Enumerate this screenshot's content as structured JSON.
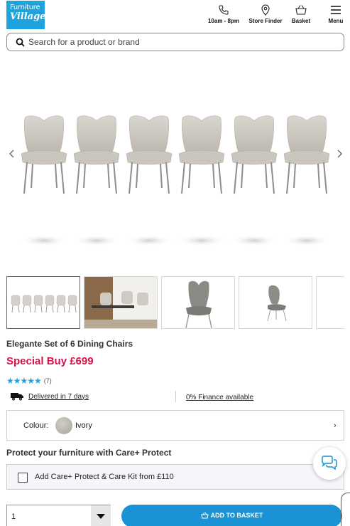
{
  "header": {
    "logo_line1": "Furniture",
    "logo_line2": "Village",
    "phone_label": "10am - 8pm",
    "store_label": "Store Finder",
    "basket_label": "Basket",
    "menu_label": "Menu"
  },
  "search": {
    "placeholder": "Search for a product or brand"
  },
  "product": {
    "title": "Elegante Set of 6 Dining Chairs",
    "price": "Special Buy £699",
    "stars": "★★★★★",
    "review_count": "(7)",
    "delivery": "Delivered in 7 days",
    "finance": "0% Finance available"
  },
  "colour": {
    "label": "Colour:",
    "value": "Ivory",
    "chevron": "›",
    "swatch_color": "#bdbab2"
  },
  "care": {
    "title": "Protect your furniture with Care+ Protect",
    "option": "Add Care+ Protect & Care Kit from £110"
  },
  "purchase": {
    "quantity": "1",
    "add_label": "ADD TO BASKET"
  },
  "colors": {
    "brand_blue": "#1ea3dc",
    "price_red": "#d6124a",
    "button_blue": "#1a93d6"
  }
}
